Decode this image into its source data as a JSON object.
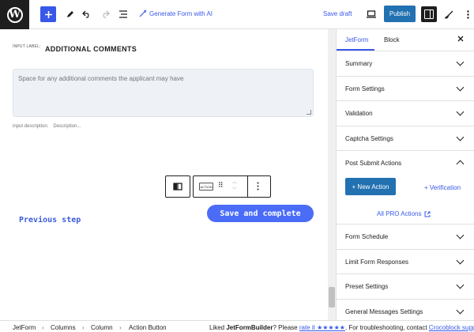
{
  "toolbar": {
    "wp_logo": "W",
    "add_icon": "plus-icon",
    "generate_label": "Generate Form with AI",
    "save_draft": "Save draft",
    "publish": "Publish"
  },
  "canvas": {
    "input_label_small": "INPUT LABEL:",
    "input_label": "ADDITIONAL COMMENTS",
    "textarea_placeholder": "Space for any additional comments the applicant may have",
    "input_desc_label": "input description:",
    "input_desc_value": "Description...",
    "action_chip": "ACTION",
    "prev_step": "Previous step",
    "save_complete": "Save and complete"
  },
  "sidebar": {
    "tabs": [
      {
        "label": "JetForm"
      },
      {
        "label": "Block"
      }
    ],
    "panels_top": [
      {
        "title": "Summary"
      },
      {
        "title": "Form Settings"
      },
      {
        "title": "Validation"
      },
      {
        "title": "Captcha Settings"
      }
    ],
    "psa": {
      "title": "Post Submit Actions",
      "new_action": "+ New Action",
      "verification": "+ Verification",
      "pro_actions": "All PRO Actions"
    },
    "panels_bottom": [
      {
        "title": "Form Schedule"
      },
      {
        "title": "Limit Form Responses"
      },
      {
        "title": "Preset Settings"
      },
      {
        "title": "General Messages Settings"
      }
    ]
  },
  "status": {
    "breadcrumbs": [
      "JetForm",
      "Columns",
      "Column",
      "Action Button"
    ],
    "liked_prefix": "Liked ",
    "liked_brand": "JetFormBuilder",
    "liked_mid": "? Please ",
    "rate_link": "rate it ★★★★★",
    "liked_tail": ". For troubleshooting, contact ",
    "support_link": "Crocoblock support"
  }
}
